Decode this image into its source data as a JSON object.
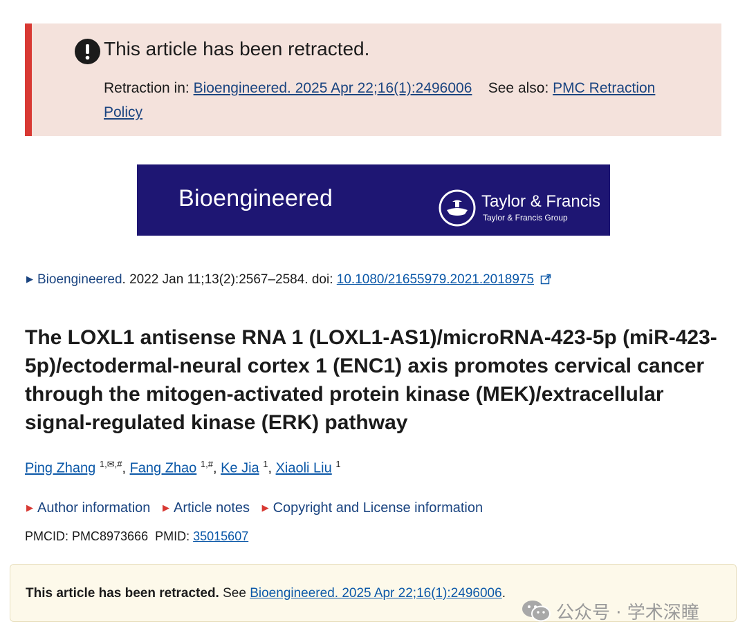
{
  "retraction_banner": {
    "title": "This article has been retracted.",
    "retraction_in_label": "Retraction in:",
    "retraction_link": "Bioengineered. 2025 Apr 22;16(1):2496006",
    "see_also_label": "See also:",
    "policy_link": "PMC Retraction Policy",
    "accent_color": "#d83933",
    "background_color": "#f4e2dc"
  },
  "journal_banner": {
    "journal_name": "Bioengineered",
    "publisher_name": "Taylor & Francis",
    "publisher_group": "Taylor & Francis Group",
    "background_color": "#1e1673"
  },
  "citation": {
    "journal_link": "Bioengineered",
    "details": ". 2022 Jan 11;13(2):2567–2584. doi: ",
    "doi_link": "10.1080/21655979.2021.2018975"
  },
  "article": {
    "title": "The LOXL1 antisense RNA 1 (LOXL1-AS1)/microRNA-423-5p (miR-423-5p)/ectodermal-neural cortex 1 (ENC1) axis promotes cervical cancer through the mitogen-activated protein kinase (MEK)/extracellular signal-regulated kinase (ERK) pathway"
  },
  "authors": [
    {
      "name": "Ping Zhang",
      "sup": "1,✉,#"
    },
    {
      "name": "Fang Zhao",
      "sup": "1,#"
    },
    {
      "name": "Ke Jia",
      "sup": "1"
    },
    {
      "name": "Xiaoli Liu",
      "sup": "1"
    }
  ],
  "expanders": {
    "author_info": "Author information",
    "article_notes": "Article notes",
    "copyright": "Copyright and License information"
  },
  "ids": {
    "pmcid_label": "PMCID: PMC8973666",
    "pmid_label": "PMID:",
    "pmid_link": "35015607"
  },
  "notice": {
    "bold_text": "This article has been retracted.",
    "see_text": "See",
    "link": "Bioengineered. 2025 Apr 22;16(1):2496006",
    "trailing": "."
  },
  "watermark": {
    "text": "公众号 · 学术深瞳"
  }
}
